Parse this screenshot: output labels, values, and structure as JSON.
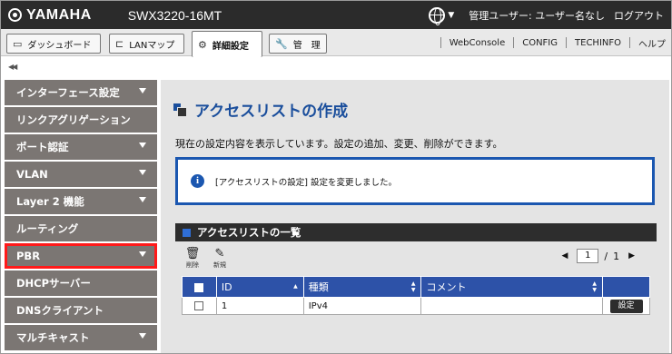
{
  "header": {
    "brand": "YAMAHA",
    "model": "SWX3220-16MT",
    "lang_caret": "▼",
    "user_info": "管理ユーザー: ユーザー名なし",
    "logout": "ログアウト"
  },
  "tabs": [
    {
      "label": "ダッシュボード",
      "icon": "dashboard-icon"
    },
    {
      "label": "LANマップ",
      "icon": "lanmap-icon"
    },
    {
      "label": "詳細設定",
      "icon": "gear-icon",
      "active": true
    },
    {
      "label": "管　理",
      "icon": "wrench-icon"
    }
  ],
  "links": [
    "WebConsole",
    "CONFIG",
    "TECHINFO",
    "ヘルプ"
  ],
  "collapse_glyph": "◀◀",
  "sidebar": {
    "items": [
      {
        "label": "インターフェース設定",
        "caret": true
      },
      {
        "label": "リンクアグリゲーション",
        "caret": false
      },
      {
        "label": "ポート認証",
        "caret": true
      },
      {
        "label": "VLAN",
        "caret": true
      },
      {
        "label": "Layer 2 機能",
        "caret": true
      },
      {
        "label": "ルーティング",
        "caret": false
      },
      {
        "label": "PBR",
        "caret": true,
        "highlighted": true
      },
      {
        "label": "DHCPサーバー",
        "caret": false
      },
      {
        "label": "DNSクライアント",
        "caret": false
      },
      {
        "label": "マルチキャスト",
        "caret": true
      }
    ]
  },
  "main": {
    "title": "アクセスリストの作成",
    "description": "現在の設定内容を表示しています。設定の追加、変更、削除ができます。",
    "notice": "[アクセスリストの設定] 設定を変更しました。",
    "list": {
      "header": "アクセスリストの一覧",
      "tools": [
        {
          "label": "削除",
          "icon": "trash-icon"
        },
        {
          "label": "新規",
          "icon": "new-edit-icon"
        }
      ],
      "pager": {
        "current": "1",
        "separator": "/",
        "total": "1",
        "prev": "◀",
        "next": "▶"
      },
      "columns": [
        "ID",
        "種類",
        "コメント"
      ],
      "rows": [
        {
          "id": "1",
          "type": "IPv4",
          "comment": "",
          "action": "設定"
        }
      ]
    }
  },
  "colors": {
    "accent_blue": "#1b57b0",
    "highlight_red": "#ff1a1a",
    "sidebar_bg": "#7b7673",
    "topbar_bg": "#2b2b2b"
  }
}
